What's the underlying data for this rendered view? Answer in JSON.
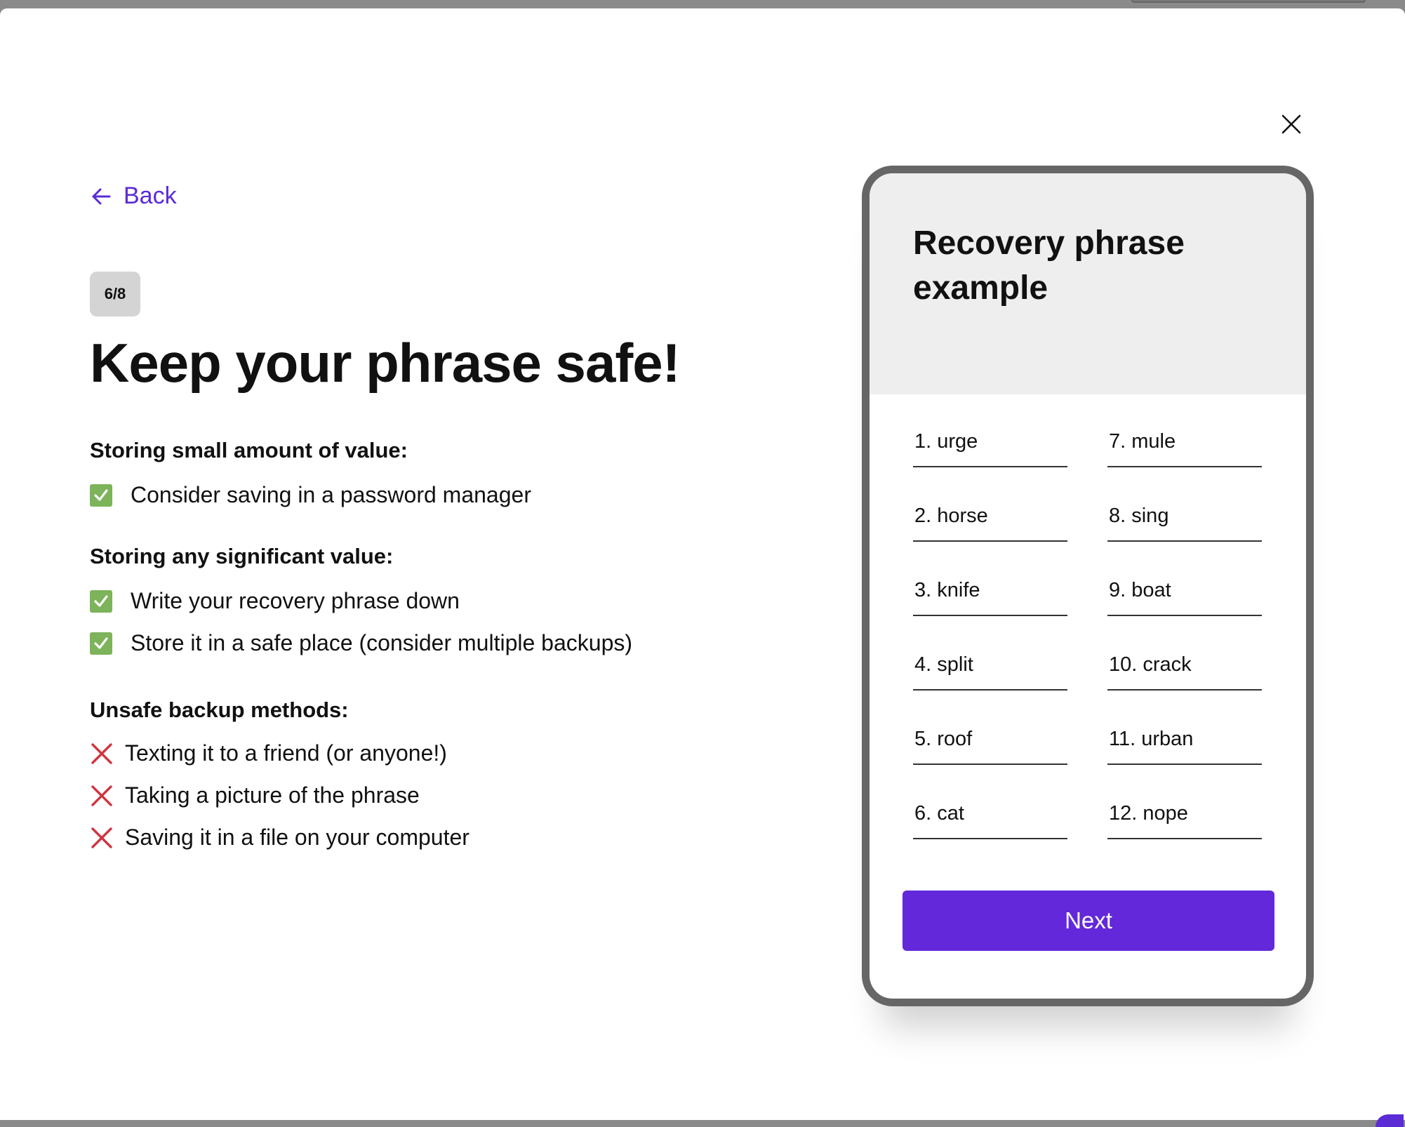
{
  "navigation": {
    "back_label": "Back"
  },
  "step": {
    "label": "6/8"
  },
  "title": "Keep your phrase safe!",
  "sections": [
    {
      "heading": "Storing small amount of value:",
      "items": [
        {
          "icon": "check-icon",
          "text": "Consider saving in a password manager"
        }
      ]
    },
    {
      "heading": "Storing any significant value:",
      "items": [
        {
          "icon": "check-icon",
          "text": "Write your recovery phrase down"
        },
        {
          "icon": "check-icon",
          "text": "Store it in a safe place (consider multiple backups)"
        }
      ]
    },
    {
      "heading": "Unsafe backup methods:",
      "items": [
        {
          "icon": "x-icon",
          "text": "Texting it to a friend (or anyone!)"
        },
        {
          "icon": "x-icon",
          "text": "Taking a picture of the phrase"
        },
        {
          "icon": "x-icon",
          "text": "Saving it in a file on your computer"
        }
      ]
    }
  ],
  "phone": {
    "title": "Recovery phrase example",
    "words": [
      "1. urge",
      "2. horse",
      "3. knife",
      "4. split",
      "5. roof",
      "6. cat",
      "7. mule",
      "8. sing",
      "9. boat",
      "10. crack",
      "11. urban",
      "12. nope"
    ],
    "next_label": "Next"
  },
  "colors": {
    "accent": "#6328da",
    "link": "#5b2bd6",
    "check": "#7db35a",
    "cross": "#d0343f"
  }
}
